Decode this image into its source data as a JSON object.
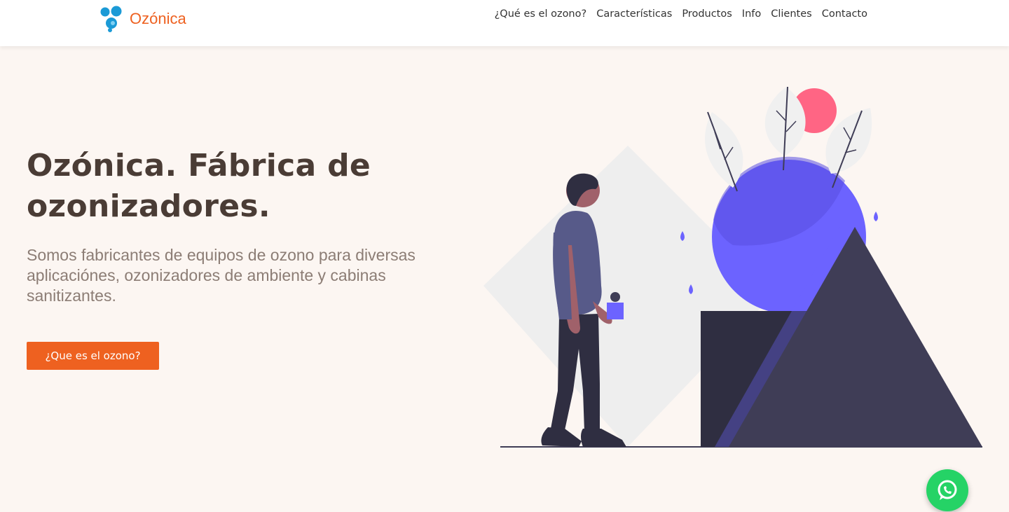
{
  "header": {
    "brand_name": "Ozónica",
    "logo_icon": "ozone-molecule-icon",
    "brand_color": "#ee6120",
    "nav": [
      {
        "label": "¿Qué es el ozono?"
      },
      {
        "label": "Características"
      },
      {
        "label": "Productos"
      },
      {
        "label": "Info"
      },
      {
        "label": "Clientes"
      },
      {
        "label": "Contacto"
      }
    ]
  },
  "hero": {
    "title": "Ozónica. Fábrica de ozonizadores.",
    "subtitle": "Somos fabricantes de equipos de ozono para diversas aplicaciónes, ozonizadores de ambiente y cabinas sanitizantes.",
    "cta_label": "¿Que es el ozono?",
    "illustration": "person-with-geometric-shapes-illustration"
  },
  "floating": {
    "whatsapp_icon": "whatsapp-icon",
    "whatsapp_color": "#25d366"
  },
  "colors": {
    "background": "#fcf6f2",
    "accent_purple": "#6c63ff",
    "dark_shape": "#3f3d56",
    "sun_pink": "#ff6584"
  }
}
